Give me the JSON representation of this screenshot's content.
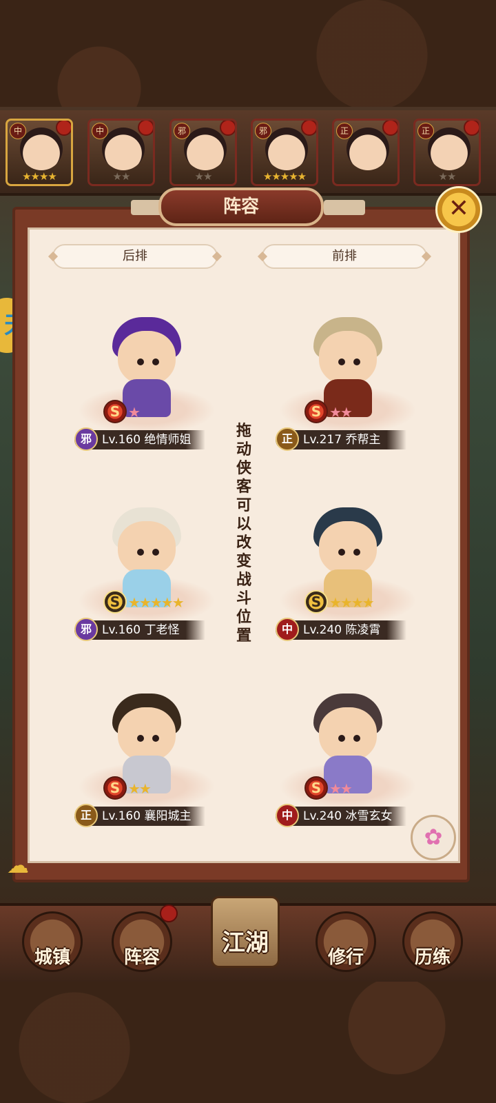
{
  "panel": {
    "title": "阵容",
    "back_row_label": "后排",
    "front_row_label": "前排",
    "hint": "拖动侠客可以改变战斗位置"
  },
  "roster_strip": [
    {
      "faction": "中",
      "stars": 4,
      "max_stars": 4,
      "selected": true
    },
    {
      "faction": "中",
      "stars": 0,
      "max_stars": 2,
      "selected": false
    },
    {
      "faction": "邪",
      "stars": 0,
      "max_stars": 2,
      "selected": false
    },
    {
      "faction": "邪",
      "stars": 5,
      "max_stars": 5,
      "selected": false
    },
    {
      "faction": "正",
      "stars": 0,
      "max_stars": 0,
      "selected": false
    },
    {
      "faction": "正",
      "stars": 0,
      "max_stars": 2,
      "selected": false
    }
  ],
  "slots": {
    "back_1": {
      "faction": "邪",
      "level": "Lv.160",
      "name": "绝情师姐",
      "stars": "★",
      "star_color": "pink"
    },
    "back_2": {
      "faction": "邪",
      "level": "Lv.160",
      "name": "丁老怪",
      "stars": "★★★★★",
      "star_color": "gold"
    },
    "back_3": {
      "faction": "正",
      "level": "Lv.160",
      "name": "襄阳城主",
      "stars": "★★",
      "star_color": "gold"
    },
    "front_1": {
      "faction": "正",
      "level": "Lv.217",
      "name": "乔帮主",
      "stars": "★★",
      "star_color": "pink"
    },
    "front_2": {
      "faction": "中",
      "level": "Lv.240",
      "name": "陈凌霄",
      "stars": "★★★★",
      "star_color": "gold"
    },
    "front_3": {
      "faction": "中",
      "level": "Lv.240",
      "name": "冰雪玄女",
      "stars": "★★",
      "star_color": "pink"
    }
  },
  "nav": {
    "town": "城镇",
    "lineup": "阵容",
    "jianghu": "江湖",
    "training": "修行",
    "experience": "历练"
  },
  "colors": {
    "panel_bg": "#f7ebde",
    "frame": "#7a3a26",
    "gold_star": "#e9b42c",
    "pink_star": "#f08a9a"
  }
}
